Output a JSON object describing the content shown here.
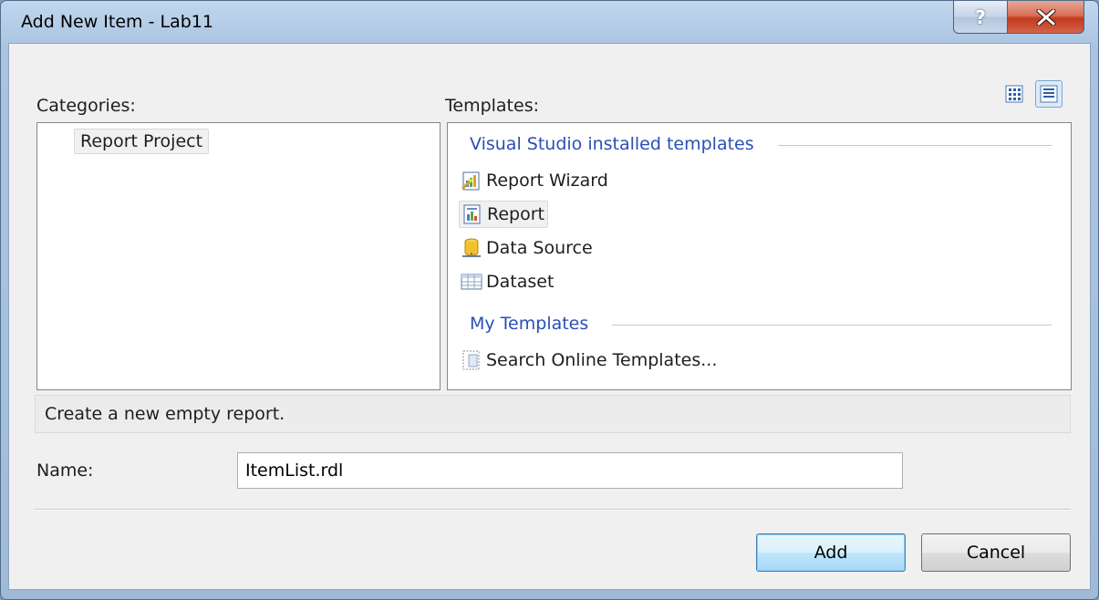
{
  "window": {
    "title": "Add New Item - Lab11",
    "help_label": "?",
    "close_icon": "close-icon"
  },
  "categories": {
    "label": "Categories:",
    "items": [
      "Report Project"
    ],
    "selected": "Report Project"
  },
  "templates": {
    "label": "Templates:",
    "view_buttons": [
      {
        "icon": "large-icons-view-icon",
        "active": false
      },
      {
        "icon": "small-icons-view-icon",
        "active": true
      }
    ],
    "groups": [
      {
        "header": "Visual Studio installed templates",
        "items": [
          {
            "label": "Report Wizard",
            "icon": "report-wizard-icon"
          },
          {
            "label": "Report",
            "icon": "report-icon",
            "selected": true
          },
          {
            "label": "Data Source",
            "icon": "data-source-icon"
          },
          {
            "label": "Dataset",
            "icon": "dataset-icon"
          }
        ]
      },
      {
        "header": "My Templates",
        "items": [
          {
            "label": "Search Online Templates...",
            "icon": "search-online-templates-icon"
          }
        ]
      }
    ]
  },
  "description": "Create a new empty report.",
  "name_field": {
    "label": "Name:",
    "value": "ItemList.rdl"
  },
  "buttons": {
    "add": "Add",
    "cancel": "Cancel"
  },
  "colors": {
    "group_header": "#2a4fb5",
    "close_button": "#c1391c",
    "title_bar": "#a9c3e0"
  }
}
